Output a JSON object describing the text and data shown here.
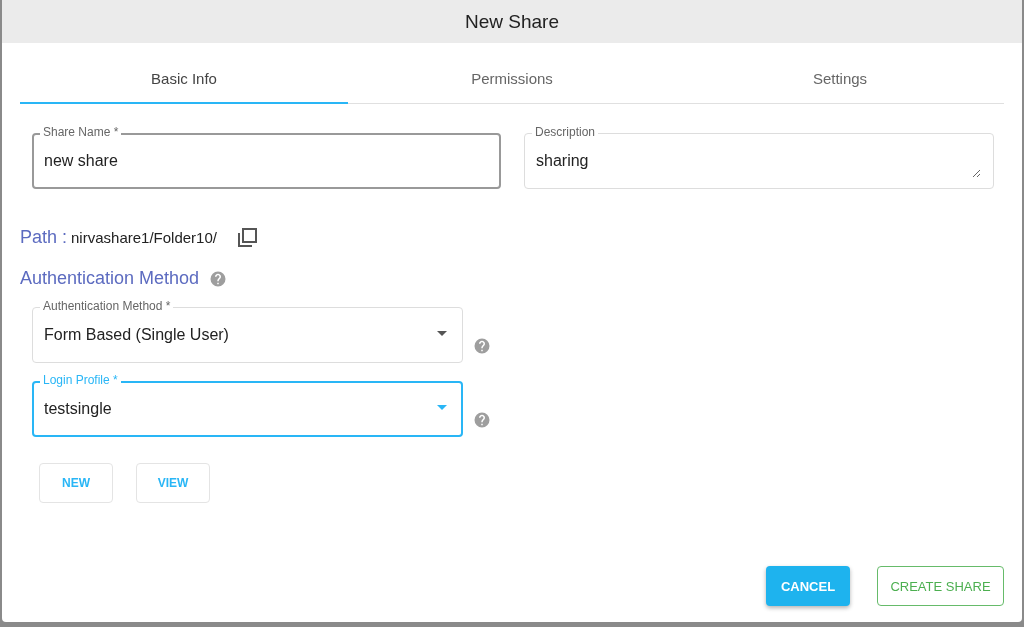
{
  "dialog": {
    "title": "New Share"
  },
  "tabs": [
    {
      "label": "Basic Info",
      "selected": true
    },
    {
      "label": "Permissions",
      "selected": false
    },
    {
      "label": "Settings",
      "selected": false
    }
  ],
  "fields": [
    {
      "kind": "text",
      "label": "Share Name *",
      "value": "new share",
      "focused": false
    },
    {
      "kind": "textarea",
      "label": "Description",
      "value": "sharing",
      "focused": false
    }
  ],
  "path": {
    "label": "Path :",
    "value": "nirvashare1/Folder10/"
  },
  "auth_section": {
    "title": "Authentication Method"
  },
  "selects": [
    {
      "label": "Authentication Method *",
      "value": "Form Based (Single User)",
      "focused": false
    },
    {
      "label": "Login Profile *",
      "value": "testsingle",
      "focused": true
    }
  ],
  "profile_buttons": [
    "NEW",
    "VIEW"
  ],
  "footer": {
    "cancel": "CANCEL",
    "create": "CREATE SHARE"
  }
}
